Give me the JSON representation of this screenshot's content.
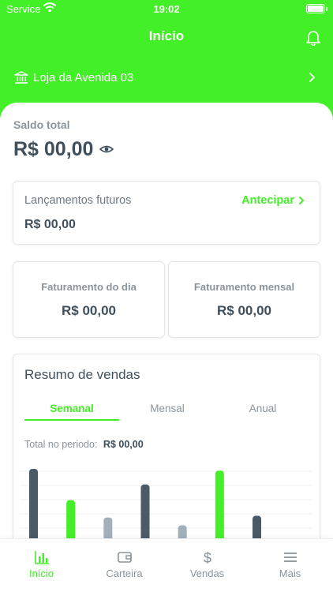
{
  "status_bar": {
    "carrier": "Service",
    "time": "19:02"
  },
  "header": {
    "title": "Início"
  },
  "store": {
    "name": "Loja da Avenida 03"
  },
  "balance": {
    "label": "Saldo total",
    "value": "R$ 00,00"
  },
  "future": {
    "label": "Lançamentos futuros",
    "action": "Antecipar",
    "value": "R$ 00,00"
  },
  "revenue_day": {
    "label": "Faturamento do dia",
    "value": "R$ 00,00"
  },
  "revenue_month": {
    "label": "Faturamento mensal",
    "value": "R$ 00,00"
  },
  "sales_summary": {
    "title": "Resumo de vendas",
    "tabs": [
      "Semanal",
      "Mensal",
      "Anual"
    ],
    "active_tab": "Semanal",
    "period_label": "Total no periodo:",
    "period_value": "R$ 00,00"
  },
  "chart_data": {
    "type": "bar",
    "values": [
      100,
      64,
      44,
      82,
      35,
      98,
      46
    ],
    "colors": [
      "#4a5a66",
      "#43ef27",
      "#a2b0b9",
      "#4a5a66",
      "#a2b0b9",
      "#43ef27",
      "#4a5a66"
    ],
    "grid": true
  },
  "nav": {
    "items": [
      {
        "label": "Início",
        "icon": "chart-bars-icon",
        "active": true
      },
      {
        "label": "Carteira",
        "icon": "wallet-icon",
        "active": false
      },
      {
        "label": "Vendas",
        "icon": "dollar-icon",
        "active": false
      },
      {
        "label": "Mais",
        "icon": "menu-icon",
        "active": false
      }
    ]
  },
  "colors": {
    "accent": "#43ef27",
    "text_dark": "#3f4f5c",
    "text_muted": "#8a949c"
  }
}
